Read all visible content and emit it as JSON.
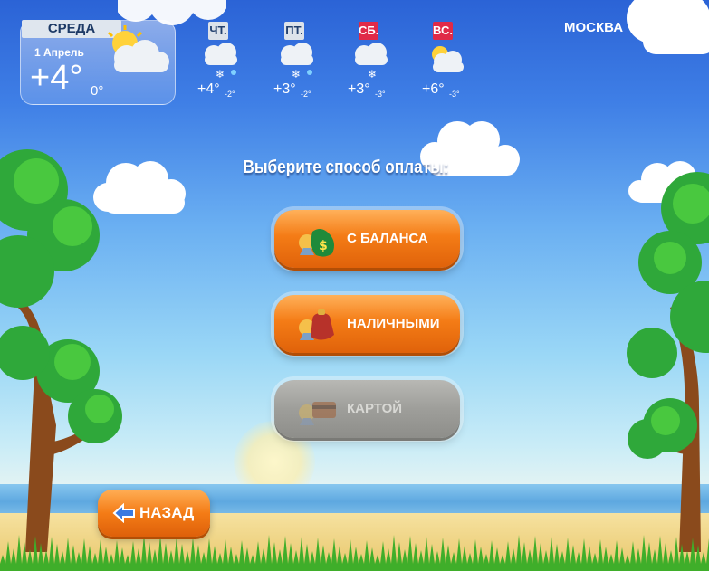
{
  "weather": {
    "today": {
      "day": "СРЕДА",
      "date": "1 Апрель",
      "temp_high": "+4°",
      "temp_low": "0°"
    },
    "forecast": [
      {
        "day": "ЧТ.",
        "weekend": false,
        "temp_high": "+4°",
        "temp_low": "-2°"
      },
      {
        "day": "ПТ.",
        "weekend": false,
        "temp_high": "+3°",
        "temp_low": "-2°"
      },
      {
        "day": "СБ.",
        "weekend": true,
        "temp_high": "+3°",
        "temp_low": "-3°"
      },
      {
        "day": "ВС.",
        "weekend": true,
        "temp_high": "+6°",
        "temp_low": "-3°"
      }
    ],
    "city": "МОСКВА"
  },
  "main": {
    "heading": "Выберите способ оплаты:",
    "options": [
      {
        "label": "С БАЛАНСА",
        "icon": "money-bag-icon",
        "enabled": true
      },
      {
        "label": "НАЛИЧНЫМИ",
        "icon": "coin-purse-icon",
        "enabled": true
      },
      {
        "label": "КАРТОЙ",
        "icon": "credit-card-icon",
        "enabled": false
      }
    ]
  },
  "footer": {
    "back_label": "НАЗАД"
  },
  "colors": {
    "button_orange": "#f47c16",
    "button_disabled": "#9e9e9a",
    "weekend_red": "#e02a48"
  }
}
